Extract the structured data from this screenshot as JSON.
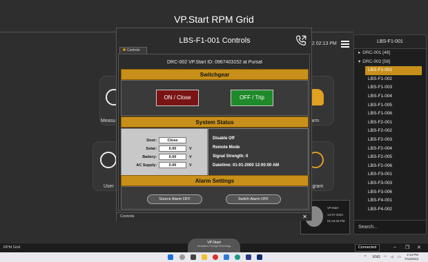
{
  "app": {
    "title": "VP.Start RPM Grid",
    "clock": "22 02:13 PM",
    "status_left": "RPM Grid",
    "connection": "Connected",
    "logo_title": "VP.Start",
    "logo_tagline": "Innovation Through Technology"
  },
  "tiles": {
    "measure_label": "Measu",
    "alarm_label": "arm",
    "user_label": "User",
    "diagram_label": "iagram"
  },
  "tree": {
    "header": "LBS-F1-001",
    "groups": [
      {
        "label": "DRC-001 [48]",
        "arrow": "▸"
      },
      {
        "label": "DRC-002 [58]",
        "arrow": "▾"
      }
    ],
    "items": [
      "LBS-F1-001",
      "LBS-F1-002",
      "LBS-F1-003",
      "LBS-F1-004",
      "LBS-F1-005",
      "LBS-F1-006",
      "LBS-F2-001",
      "LBS-F2-002",
      "LBS-F2-003",
      "LBS-F2-004",
      "LBS-F2-005",
      "LBS-F2-006",
      "LBS-F3-001",
      "LBS-F3-003",
      "LBS-F3-006",
      "LBS-F4-001",
      "LBS-F4-002"
    ],
    "selected_index": 0,
    "search_placeholder": "Search..."
  },
  "thumbnail": {
    "name": "VP.Start",
    "date": "13-07-2022",
    "time": "01:43:40 PM"
  },
  "dialog": {
    "title": "LBS-F1-001 Controls",
    "tab_label": "Controls",
    "device_line": "DRC-002 VP.Start ID: 0967403152 at Pursat",
    "switchgear_title": "Switchgear",
    "on_close_label": "ON / Close",
    "off_trip_label": "OFF / Trip",
    "system_status_title": "System Status",
    "status_fields": [
      {
        "label": "Door:",
        "value": "Close",
        "unit": ""
      },
      {
        "label": "Solar:",
        "value": "0.00",
        "unit": "V"
      },
      {
        "label": "Battery:",
        "value": "0.00",
        "unit": "V"
      },
      {
        "label": "AC Supply:",
        "value": "0.00",
        "unit": "V"
      }
    ],
    "status_lines": [
      "Disable Off",
      "Remote Mode",
      "Signal Strength: 0",
      "Datetime: 01-01-2000 12:00:00 AM"
    ],
    "alarm_title": "Alarm Settings",
    "source_alarm_label": "Source Alarm OFF",
    "switch_alarm_label": "Switch Alarm OFF",
    "footer_label": "Controls",
    "close_glyph": "✕"
  },
  "taskbar": {
    "lang": "ENG",
    "time": "2:13 PM",
    "date": "7/13/2022"
  },
  "colors": {
    "accent": "#c8901a",
    "on_button": "#7a1414",
    "off_button": "#1f8a2a"
  }
}
